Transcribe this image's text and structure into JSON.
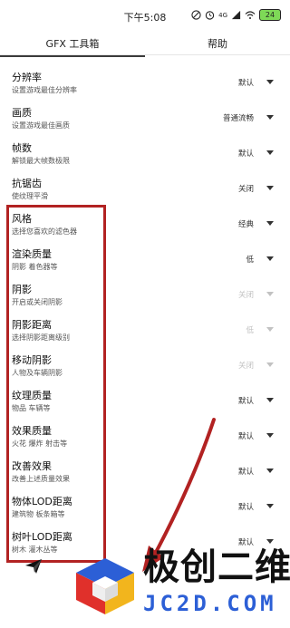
{
  "status_bar": {
    "time": "下午5:08",
    "signal_label": "4G",
    "battery": "24"
  },
  "tabs": [
    {
      "label": "GFX 工具箱",
      "active": true
    },
    {
      "label": "帮助",
      "active": false
    }
  ],
  "settings": [
    {
      "title": "分辨率",
      "desc": "设置游戏最佳分辨率",
      "value": "默认",
      "disabled": false
    },
    {
      "title": "画质",
      "desc": "设置游戏最佳画质",
      "value": "普通流畅",
      "disabled": false
    },
    {
      "title": "帧数",
      "desc": "解锁最大帧数极限",
      "value": "默认",
      "disabled": false
    },
    {
      "title": "抗锯齿",
      "desc": "使纹理平滑",
      "value": "关闭",
      "disabled": false
    },
    {
      "title": "风格",
      "desc": "选择您喜欢的滤色器",
      "value": "经典",
      "disabled": false
    },
    {
      "title": "渲染质量",
      "desc": "阴影 着色器等",
      "value": "低",
      "disabled": false
    },
    {
      "title": "阴影",
      "desc": "开启或关闭阴影",
      "value": "关闭",
      "disabled": true
    },
    {
      "title": "阴影距离",
      "desc": "选择阴影距离级别",
      "value": "低",
      "disabled": true
    },
    {
      "title": "移动阴影",
      "desc": "人物及车辆阴影",
      "value": "关闭",
      "disabled": true
    },
    {
      "title": "纹理质量",
      "desc": "物品 车辆等",
      "value": "默认",
      "disabled": false
    },
    {
      "title": "效果质量",
      "desc": "火花 爆炸 射击等",
      "value": "默认",
      "disabled": false
    },
    {
      "title": "改善效果",
      "desc": "改善上述质量效果",
      "value": "默认",
      "disabled": false
    },
    {
      "title": "物体LOD距离",
      "desc": "建筑物 板条箱等",
      "value": "默认",
      "disabled": false
    },
    {
      "title": "树叶LOD距离",
      "desc": "树木 灌木丛等",
      "value": "默认",
      "disabled": false
    }
  ],
  "watermark": {
    "title": "极创二维",
    "domain": "JC2D.COM"
  },
  "colors": {
    "highlight": "#b22222",
    "domain": "#2c5fd6",
    "disabled_text": "#c2c2c2"
  }
}
